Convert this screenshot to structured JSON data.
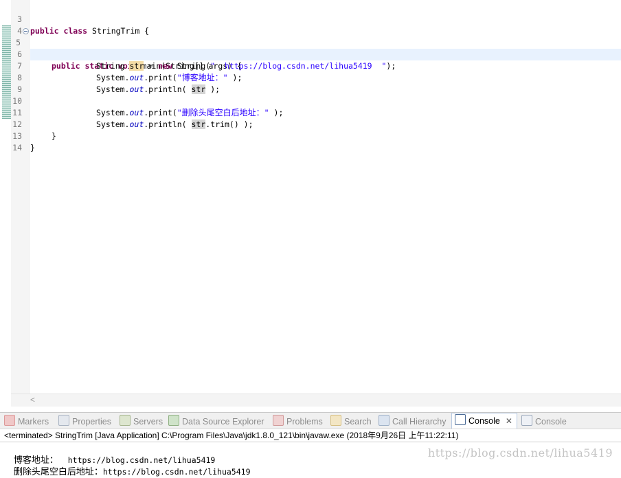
{
  "editor": {
    "lines": [
      {
        "n": "3"
      },
      {
        "n": "4"
      },
      {
        "n": "5"
      },
      {
        "n": "6"
      },
      {
        "n": "7"
      },
      {
        "n": "8"
      },
      {
        "n": "9"
      },
      {
        "n": "10"
      },
      {
        "n": "11"
      },
      {
        "n": "12"
      },
      {
        "n": "13"
      },
      {
        "n": "14"
      }
    ],
    "tokens": {
      "l3_kw": "public class",
      "l3_rest": " StringTrim {",
      "l5_kw1": "public static void",
      "l5_rest": " main(String[] args) {",
      "l6_a": "String ",
      "l6_var": "str",
      "l6_b": " = ",
      "l6_kw": "new",
      "l6_c": " String(",
      "l6_str": "\"  https://blog.csdn.net/lihua5419  \"",
      "l6_d": ");",
      "l7_a": "System.",
      "l7_fld": "out",
      "l7_b": ".print(",
      "l7_str_q1": "\"",
      "l7_str_cjk": "博客地址：",
      "l7_str_q2": "\"",
      "l7_c": " );",
      "l8_a": "System.",
      "l8_fld": "out",
      "l8_b": ".println( ",
      "l8_var": "str",
      "l8_c": " );",
      "l10_a": "System.",
      "l10_fld": "out",
      "l10_b": ".print(",
      "l10_str_q1": "\"",
      "l10_str_cjk": "删除头尾空白后地址：",
      "l10_str_q2": "\"",
      "l10_c": " );",
      "l11_a": "System.",
      "l11_fld": "out",
      "l11_b": ".println( ",
      "l11_var": "str",
      "l11_c": ".trim() );",
      "l12": "}",
      "l13": "}"
    },
    "scroll_left_glyph": "<"
  },
  "views": {
    "tabs": [
      {
        "label": "Markers"
      },
      {
        "label": "Properties"
      },
      {
        "label": "Servers"
      },
      {
        "label": "Data Source Explorer"
      },
      {
        "label": "Problems"
      },
      {
        "label": "Search"
      },
      {
        "label": "Call Hierarchy"
      },
      {
        "label": "Console"
      },
      {
        "label": "Console"
      }
    ],
    "close_glyph": "✕"
  },
  "console": {
    "header": "<terminated> StringTrim [Java Application] C:\\Program Files\\Java\\jdk1.8.0_121\\bin\\javaw.exe (2018年9月26日 上午11:22:11)",
    "out1_cjk": "博客地址：",
    "out1_rest": "  https://blog.csdn.net/lihua5419",
    "out2_cjk": "删除头尾空白后地址：",
    "out2_rest": "https://blog.csdn.net/lihua5419"
  },
  "watermark": "https://blog.csdn.net/lihua5419",
  "colors": {
    "keyword": "#7f0055",
    "string": "#2a00ff",
    "field": "#0000c0",
    "current_line": "#e8f2fe"
  }
}
